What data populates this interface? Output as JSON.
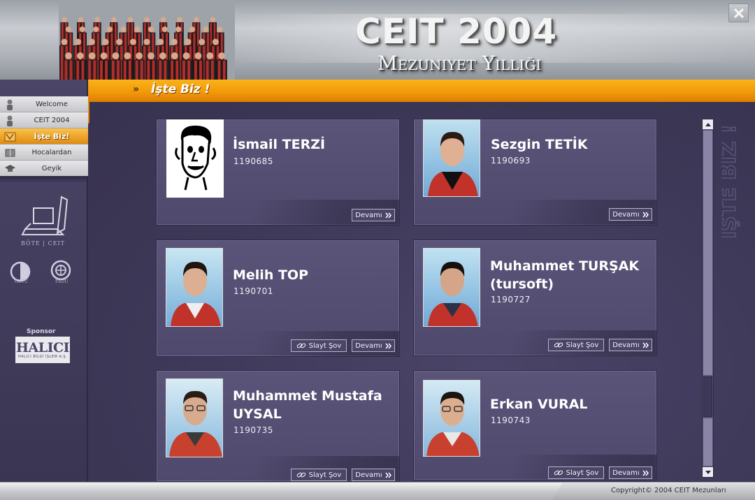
{
  "header": {
    "title": "CEIT 2004",
    "subtitle": "Mezuniyet Yıllığı",
    "close_icon": "close-icon"
  },
  "section": {
    "chevron": "»",
    "title": "İşte Biz !"
  },
  "sidebar": {
    "items": [
      {
        "label": "Welcome",
        "icon": "person-icon",
        "active": false
      },
      {
        "label": "CEIT 2004",
        "icon": "person-icon",
        "active": false
      },
      {
        "label": "İşte Biz!",
        "icon": "folder-icon",
        "active": true
      },
      {
        "label": "Hocalardan",
        "icon": "book-icon",
        "active": false
      },
      {
        "label": "Geyik",
        "icon": "graduation-cap-icon",
        "active": false
      }
    ],
    "bote_logo_text": "BÖTE | CEIT",
    "university_logos": [
      "ODTÜ",
      "FEDU"
    ],
    "sponsor_label": "Sponsor",
    "sponsor_name": "HALICI",
    "sponsor_subtitle": "HALICI BİLGİ İŞLEM A.Ş."
  },
  "watermark_text": "İŞTE BİZ !",
  "cards": [
    {
      "name": "İsmail TERZİ",
      "id": "1190685",
      "photo": "caricature",
      "buttons": [
        "Devamı"
      ]
    },
    {
      "name": "Sezgin TETİK",
      "id": "1190693",
      "photo": "portrait",
      "buttons": [
        "Devamı"
      ]
    },
    {
      "name": "Melih TOP",
      "id": "1190701",
      "photo": "portrait",
      "buttons": [
        "Slayt Şov",
        "Devamı"
      ]
    },
    {
      "name": "Muhammet TURŞAK (tursoft)",
      "id": "1190727",
      "photo": "portrait",
      "buttons": [
        "Slayt Şov",
        "Devamı"
      ]
    },
    {
      "name": "Muhammet Mustafa UYSAL",
      "id": "1190735",
      "photo": "portrait",
      "buttons": [
        "Slayt Şov",
        "Devamı"
      ]
    },
    {
      "name": "Erkan VURAL",
      "id": "1190743",
      "photo": "portrait",
      "buttons": [
        "Slayt Şov",
        "Devamı"
      ]
    }
  ],
  "buttons": {
    "more_label": "Devamı",
    "more_icon": "double-chevron-right-icon",
    "slideshow_label": "Slayt Şov",
    "slideshow_icon": "link-icon"
  },
  "footer": {
    "copyright": "Copyright©  2004 CEIT Mezunları"
  },
  "colors": {
    "accent_orange": "#f29a0a",
    "panel_purple": "#4f496d",
    "background": "#3b3654"
  }
}
